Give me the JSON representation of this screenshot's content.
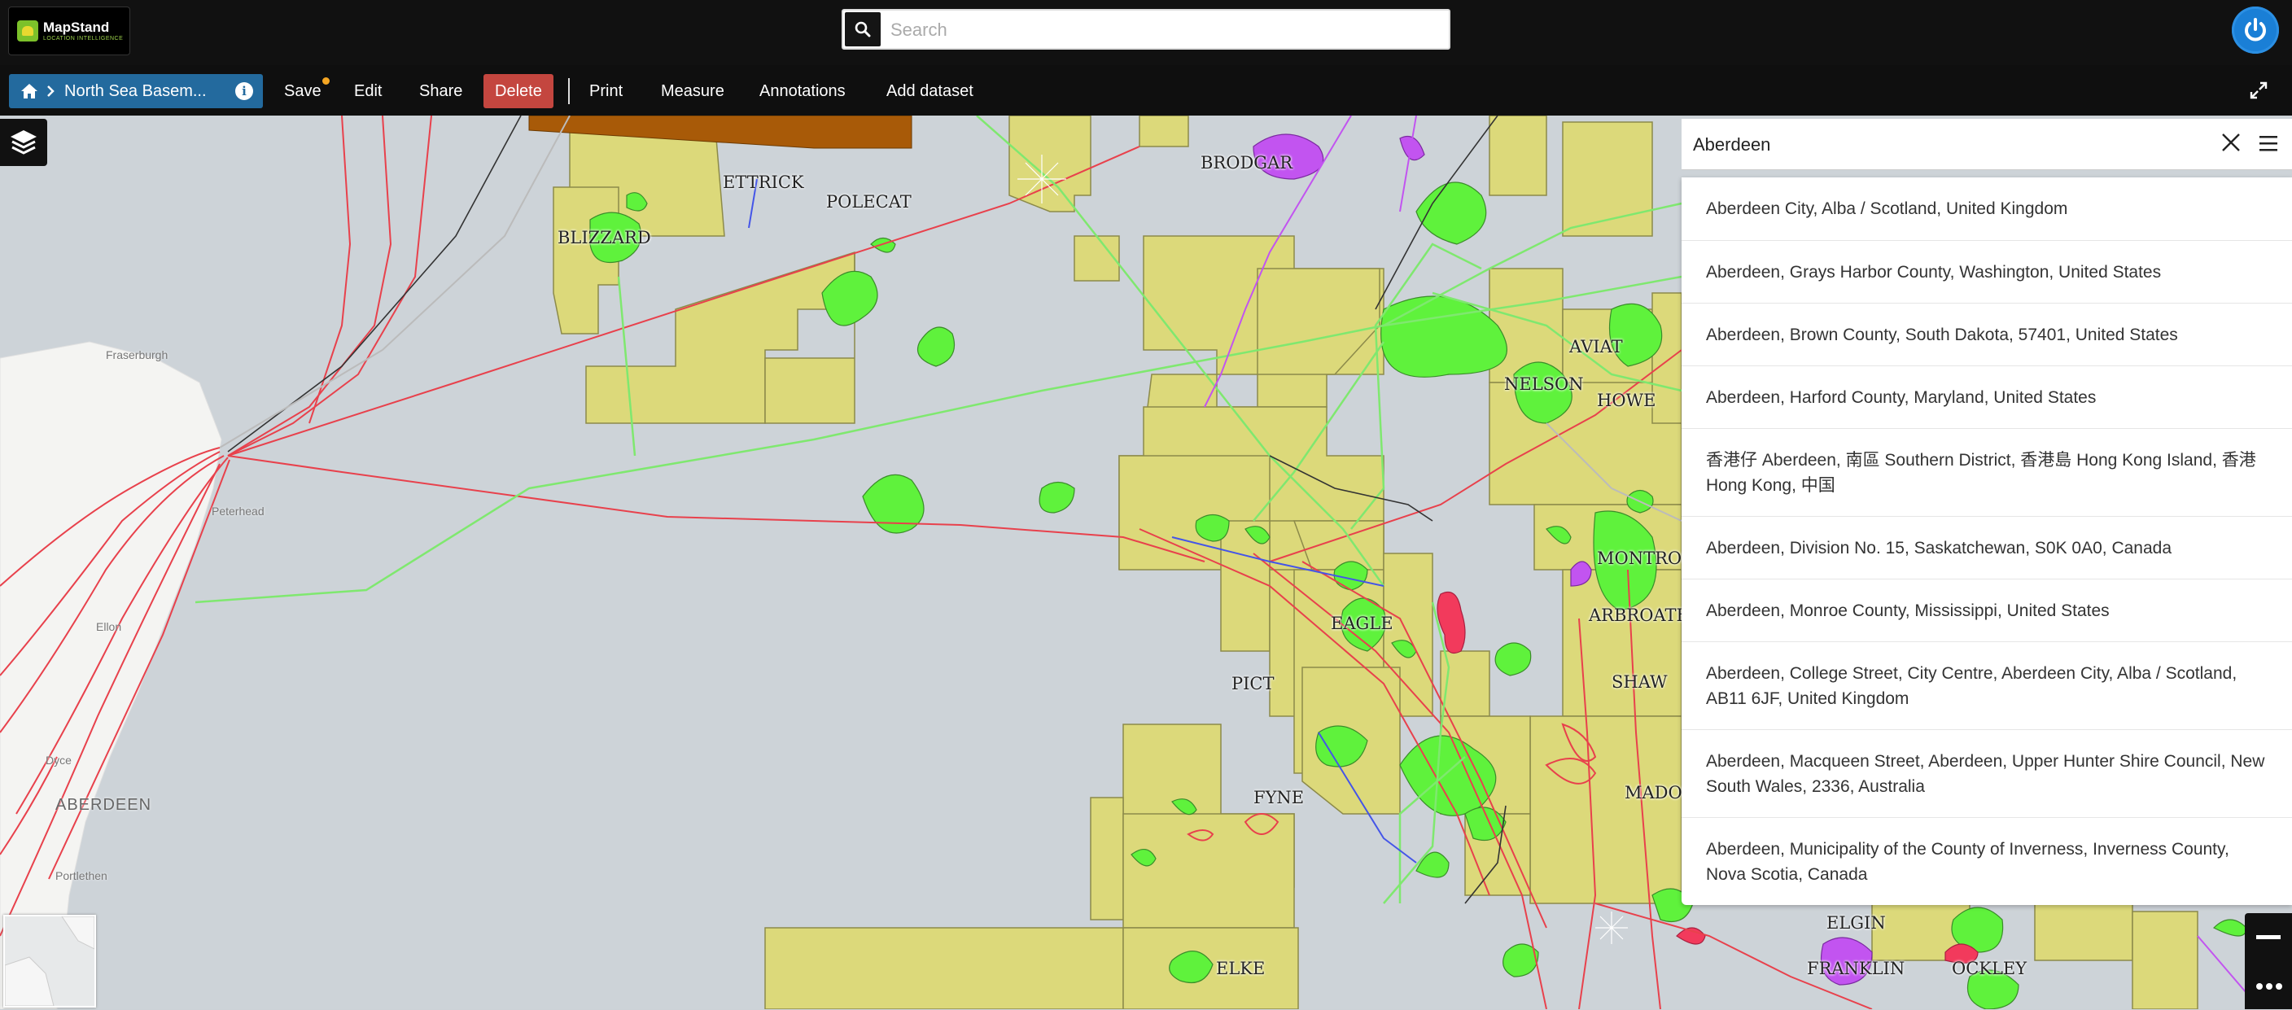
{
  "app": {
    "logo_name": "MapStand",
    "logo_sub": "LOCATION INTELLIGENCE",
    "search_placeholder": "Search"
  },
  "toolbar": {
    "breadcrumb_title": "North Sea Basem...",
    "save": "Save",
    "edit": "Edit",
    "share": "Share",
    "delete": "Delete",
    "print": "Print",
    "measure": "Measure",
    "annotations": "Annotations",
    "add_dataset": "Add dataset"
  },
  "location_search": {
    "value": "Aberdeen",
    "results": [
      "Aberdeen City, Alba / Scotland, United Kingdom",
      "Aberdeen, Grays Harbor County, Washington, United States",
      "Aberdeen, Brown County, South Dakota, 57401, United States",
      "Aberdeen, Harford County, Maryland, United States",
      "香港仔 Aberdeen, 南區 Southern District, 香港島 Hong Kong Island, 香港 Hong Kong, 中国",
      "Aberdeen, Division No. 15, Saskatchewan, S0K 0A0, Canada",
      "Aberdeen, Monroe County, Mississippi, United States",
      "Aberdeen, College Street, City Centre, Aberdeen City, Alba / Scotland, AB11 6JF, United Kingdom",
      "Aberdeen, Macqueen Street, Aberdeen, Upper Hunter Shire Council, New South Wales, 2336, Australia",
      "Aberdeen, Municipality of the County of Inverness, Inverness County, Nova Scotia, Canada"
    ]
  },
  "map": {
    "field_labels": {
      "ettrick": "ETTRICK",
      "polecat": "POLECAT",
      "blizzard": "BLIZZARD",
      "brodgar": "BRODGAR",
      "aviat": "AVIAT",
      "nelson": "NELSON",
      "howe": "HOWE",
      "montrose": "MONTROSE",
      "arbroath": "ARBROATH",
      "eagle": "EAGLE",
      "pict": "PICT",
      "shaw": "SHAW",
      "fyne": "FYNE",
      "madoes": "MADOES",
      "elgin": "ELGIN",
      "franklin": "FRANKLIN",
      "ockley": "OCKLEY",
      "elke": "ELKE"
    },
    "places": {
      "fraserburgh": "Fraserburgh",
      "peterhead": "Peterhead",
      "ellon": "Ellon",
      "dyce": "Dyce",
      "aberdeen": "ABERDEEN",
      "portlethen": "Portlethen"
    }
  },
  "colors": {
    "licence_fill": "#dcd97a",
    "field_green": "#5ff23c",
    "pipeline_red": "#e8414c",
    "pipeline_green": "#7fe86f",
    "accent_blue": "#236a9e",
    "delete_red": "#c4463f"
  }
}
